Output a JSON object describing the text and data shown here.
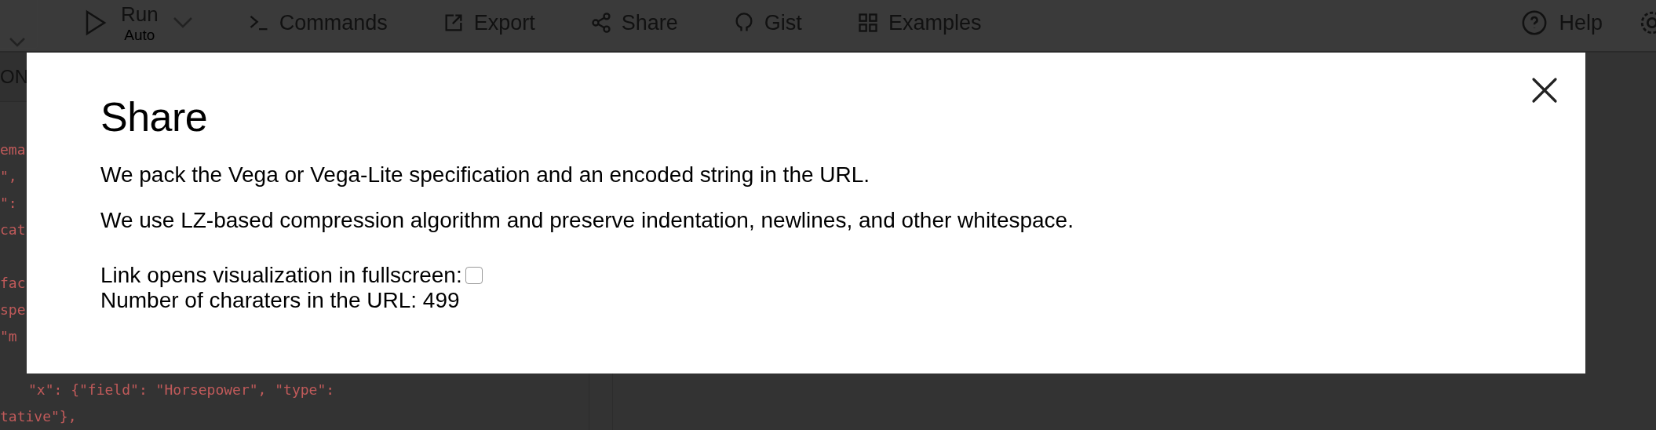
{
  "toolbar": {
    "run": {
      "label": "Run",
      "mode": "Auto"
    },
    "items": [
      {
        "kind": "commands",
        "label": "Commands"
      },
      {
        "kind": "export",
        "label": "Export"
      },
      {
        "kind": "share",
        "label": "Share"
      },
      {
        "kind": "gist",
        "label": "Gist"
      },
      {
        "kind": "examples",
        "label": "Examples"
      }
    ],
    "help": {
      "label": "Help"
    }
  },
  "editor": {
    "header": "ON",
    "lines": [
      "ema",
      "\",",
      "\":",
      "cat",
      "fac",
      "spe",
      "\"m"
    ],
    "visible_lines": [
      "\"x\": {\"field\": \"Horsepower\", \"type\":",
      "tative\"},"
    ]
  },
  "dialog": {
    "title": "Share",
    "paragraphs": [
      "We pack the Vega or Vega-Lite specification and an encoded string in the URL.",
      "We use LZ-based compression algorithm and preserve indentation, newlines, and other whitespace."
    ],
    "fullscreen": {
      "label": "Link opens visualization in fullscreen:",
      "checked": false
    },
    "count": "Number of charaters in the URL: 499"
  }
}
